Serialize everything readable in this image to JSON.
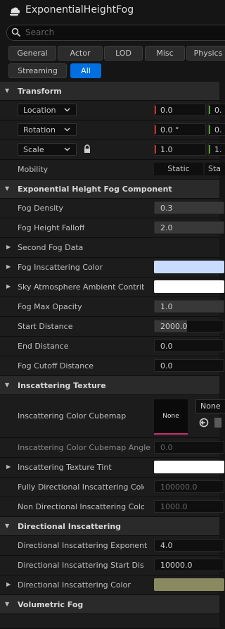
{
  "window": {
    "title": "ExponentialHeightFog"
  },
  "search": {
    "placeholder": "Search"
  },
  "filters": [
    "General",
    "Actor",
    "LOD",
    "Misc",
    "Physics",
    "Streaming",
    "All"
  ],
  "active_filter": "All",
  "colors": {
    "accent": "#0070e0",
    "inscattering_color": "#c9dcff",
    "ambient_color": "#ffffff",
    "tint_color": "#ffffff",
    "directional_color": "#8a8a60",
    "cubemap_underline": "#c83070"
  },
  "transform": {
    "header": "Transform",
    "location": {
      "label": "Location",
      "x": "0.0",
      "y": "0."
    },
    "rotation": {
      "label": "Rotation",
      "x": "0.0 °",
      "y": "0."
    },
    "scale": {
      "label": "Scale",
      "x": "1.0",
      "y": "1."
    },
    "mobility": {
      "label": "Mobility",
      "static": "Static",
      "stationary": "Sta"
    }
  },
  "fog": {
    "header": "Exponential Height Fog Component",
    "density": {
      "label": "Fog Density",
      "value": "0.3"
    },
    "height_falloff": {
      "label": "Fog Height Falloff",
      "value": "2.0"
    },
    "second": {
      "label": "Second Fog Data"
    },
    "inscattering_color": {
      "label": "Fog Inscattering Color"
    },
    "sky_ambient": {
      "label": "Sky Atmosphere Ambient Contrib..."
    },
    "max_opacity": {
      "label": "Fog Max Opacity",
      "value": "1.0"
    },
    "start_distance": {
      "label": "Start Distance",
      "value": "2000.0"
    },
    "end_distance": {
      "label": "End Distance",
      "value": "0.0"
    },
    "cutoff_distance": {
      "label": "Fog Cutoff Distance",
      "value": "0.0"
    }
  },
  "texture": {
    "header": "Inscattering Texture",
    "cubemap": {
      "label": "Inscattering Color Cubemap",
      "thumb": "None",
      "combo": "None"
    },
    "cubemap_angle": {
      "label": "Inscattering Color Cubemap Angle",
      "value": "0.0"
    },
    "tint": {
      "label": "Inscattering Texture Tint"
    },
    "fully_dir": {
      "label": "Fully Directional Inscattering Colo...",
      "value": "100000.0"
    },
    "non_dir": {
      "label": "Non Directional Inscattering Color...",
      "value": "1000.0"
    }
  },
  "directional": {
    "header": "Directional Inscattering",
    "exponent": {
      "label": "Directional Inscattering Exponent",
      "value": "4.0"
    },
    "start_distance": {
      "label": "Directional Inscattering Start Dist...",
      "value": "10000.0"
    },
    "color": {
      "label": "Directional Inscattering Color"
    }
  },
  "volumetric": {
    "header": "Volumetric Fog"
  }
}
